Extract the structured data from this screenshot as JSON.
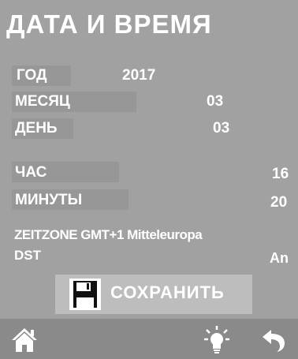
{
  "title": "ДАТА И ВРЕМЯ",
  "rows": {
    "year": {
      "label": "ГОД",
      "value": "2017"
    },
    "month": {
      "label": "МЕСЯЦ",
      "value": "03"
    },
    "day": {
      "label": "ДЕНЬ",
      "value": "03"
    },
    "hour": {
      "label": "ЧАС",
      "value": "16"
    },
    "minutes": {
      "label": "МИНУТЫ",
      "value": "20"
    }
  },
  "timezone": {
    "text": "ZEITZONE GMT+1 Mitteleuropa",
    "dst_label": "DST",
    "dst_value": "An"
  },
  "save_button": {
    "label": "СОХРАНИТЬ",
    "icon": "floppy-disk-icon"
  },
  "bottom_nav": {
    "home_icon": "home-icon",
    "light_icon": "lightbulb-icon",
    "back_icon": "back-arrow-icon"
  },
  "colors": {
    "background": "#a1a1a1",
    "row_highlight": "#979797",
    "button_bg": "#bdbdbd",
    "bottombar": "#8a8a8a",
    "text": "#ffffff"
  }
}
